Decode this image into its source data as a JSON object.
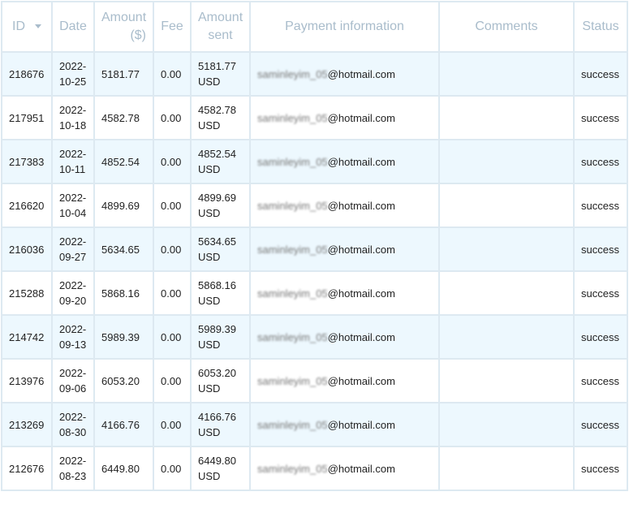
{
  "headers": {
    "id": "ID",
    "date": "Date",
    "amount": "Amount ($)",
    "fee": "Fee",
    "amount_sent": "Amount sent",
    "payment": "Payment information",
    "comments": "Comments",
    "status": "Status"
  },
  "rows": [
    {
      "id": "218676",
      "date": "2022-10-25",
      "amount": "5181.77",
      "fee": "0.00",
      "sent": "5181.77 USD",
      "email_user": "saminleyim_05",
      "email_domain": "@hotmail.com",
      "comments": "",
      "status": "success"
    },
    {
      "id": "217951",
      "date": "2022-10-18",
      "amount": "4582.78",
      "fee": "0.00",
      "sent": "4582.78 USD",
      "email_user": "saminleyim_05",
      "email_domain": "@hotmail.com",
      "comments": "",
      "status": "success"
    },
    {
      "id": "217383",
      "date": "2022-10-11",
      "amount": "4852.54",
      "fee": "0.00",
      "sent": "4852.54 USD",
      "email_user": "saminleyim_05",
      "email_domain": "@hotmail.com",
      "comments": "",
      "status": "success"
    },
    {
      "id": "216620",
      "date": "2022-10-04",
      "amount": "4899.69",
      "fee": "0.00",
      "sent": "4899.69 USD",
      "email_user": "saminleyim_05",
      "email_domain": "@hotmail.com",
      "comments": "",
      "status": "success"
    },
    {
      "id": "216036",
      "date": "2022-09-27",
      "amount": "5634.65",
      "fee": "0.00",
      "sent": "5634.65 USD",
      "email_user": "saminleyim_05",
      "email_domain": "@hotmail.com",
      "comments": "",
      "status": "success"
    },
    {
      "id": "215288",
      "date": "2022-09-20",
      "amount": "5868.16",
      "fee": "0.00",
      "sent": "5868.16 USD",
      "email_user": "saminleyim_05",
      "email_domain": "@hotmail.com",
      "comments": "",
      "status": "success"
    },
    {
      "id": "214742",
      "date": "2022-09-13",
      "amount": "5989.39",
      "fee": "0.00",
      "sent": "5989.39 USD",
      "email_user": "saminleyim_05",
      "email_domain": "@hotmail.com",
      "comments": "",
      "status": "success"
    },
    {
      "id": "213976",
      "date": "2022-09-06",
      "amount": "6053.20",
      "fee": "0.00",
      "sent": "6053.20 USD",
      "email_user": "saminleyim_05",
      "email_domain": "@hotmail.com",
      "comments": "",
      "status": "success"
    },
    {
      "id": "213269",
      "date": "2022-08-30",
      "amount": "4166.76",
      "fee": "0.00",
      "sent": "4166.76 USD",
      "email_user": "saminleyim_05",
      "email_domain": "@hotmail.com",
      "comments": "",
      "status": "success"
    },
    {
      "id": "212676",
      "date": "2022-08-23",
      "amount": "6449.80",
      "fee": "0.00",
      "sent": "6449.80 USD",
      "email_user": "saminleyim_05",
      "email_domain": "@hotmail.com",
      "comments": "",
      "status": "success"
    }
  ]
}
